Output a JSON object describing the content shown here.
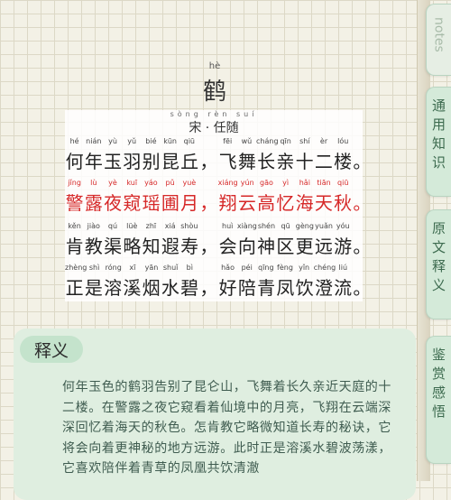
{
  "tabs": {
    "notes": "notes",
    "t1": "通用知识",
    "t2": "原文释义",
    "t3": "鉴赏感悟"
  },
  "poem": {
    "title_pinyin": "hè",
    "title": "鹤",
    "author_pinyin": "sòng  rèn  suí",
    "author": "宋 · 任随",
    "lines": [
      {
        "py": [
          "hé",
          "nián",
          "yù",
          "yǔ",
          "bié",
          "kūn",
          "qiū",
          "",
          "fēi",
          "wǔ",
          "cháng",
          "qīn",
          "shí",
          "èr",
          "lóu",
          ""
        ],
        "tx": [
          "何",
          "年",
          "玉",
          "羽",
          "别",
          "昆",
          "丘",
          "，",
          "飞",
          "舞",
          "长",
          "亲",
          "十",
          "二",
          "楼",
          "。"
        ]
      },
      {
        "py": [
          "jǐng",
          "lù",
          "yè",
          "kuī",
          "yáo",
          "pǔ",
          "yuè",
          "",
          "xiáng",
          "yún",
          "gāo",
          "yì",
          "hǎi",
          "tiān",
          "qiū",
          ""
        ],
        "tx": [
          "警",
          "露",
          "夜",
          "窥",
          "瑶",
          "圃",
          "月",
          "，",
          "翔",
          "云",
          "高",
          "忆",
          "海",
          "天",
          "秋",
          "。"
        ]
      },
      {
        "py": [
          "kěn",
          "jiào",
          "qú",
          "lüè",
          "zhī",
          "xiá",
          "shòu",
          "",
          "huì",
          "xiàng",
          "shén",
          "qū",
          "gèng",
          "yuǎn",
          "yóu",
          ""
        ],
        "tx": [
          "肯",
          "教",
          "渠",
          "略",
          "知",
          "遐",
          "寿",
          "，",
          "会",
          "向",
          "神",
          "区",
          "更",
          "远",
          "游",
          "。"
        ]
      },
      {
        "py": [
          "zhèng",
          "shì",
          "róng",
          "xī",
          "yān",
          "shuǐ",
          "bì",
          "",
          "hǎo",
          "péi",
          "qīng",
          "fèng",
          "yǐn",
          "chéng",
          "liú",
          ""
        ],
        "tx": [
          "正",
          "是",
          "溶",
          "溪",
          "烟",
          "水",
          "碧",
          "，",
          "好",
          "陪",
          "青",
          "凤",
          "饮",
          "澄",
          "流",
          "。"
        ]
      }
    ]
  },
  "explanation": {
    "heading": "释义",
    "text": "何年玉色的鹤羽告别了昆仑山，飞舞着长久亲近天庭的十二楼。在警露之夜它窥看着仙境中的月亮，飞翔在云端深深回忆着海天的秋色。怎肯教它略微知道长寿的秘诀，它将会向着更神秘的地方远游。此时正是溶溪水碧波荡漾，它喜欢陪伴着青草的凤凰共饮清澈"
  }
}
